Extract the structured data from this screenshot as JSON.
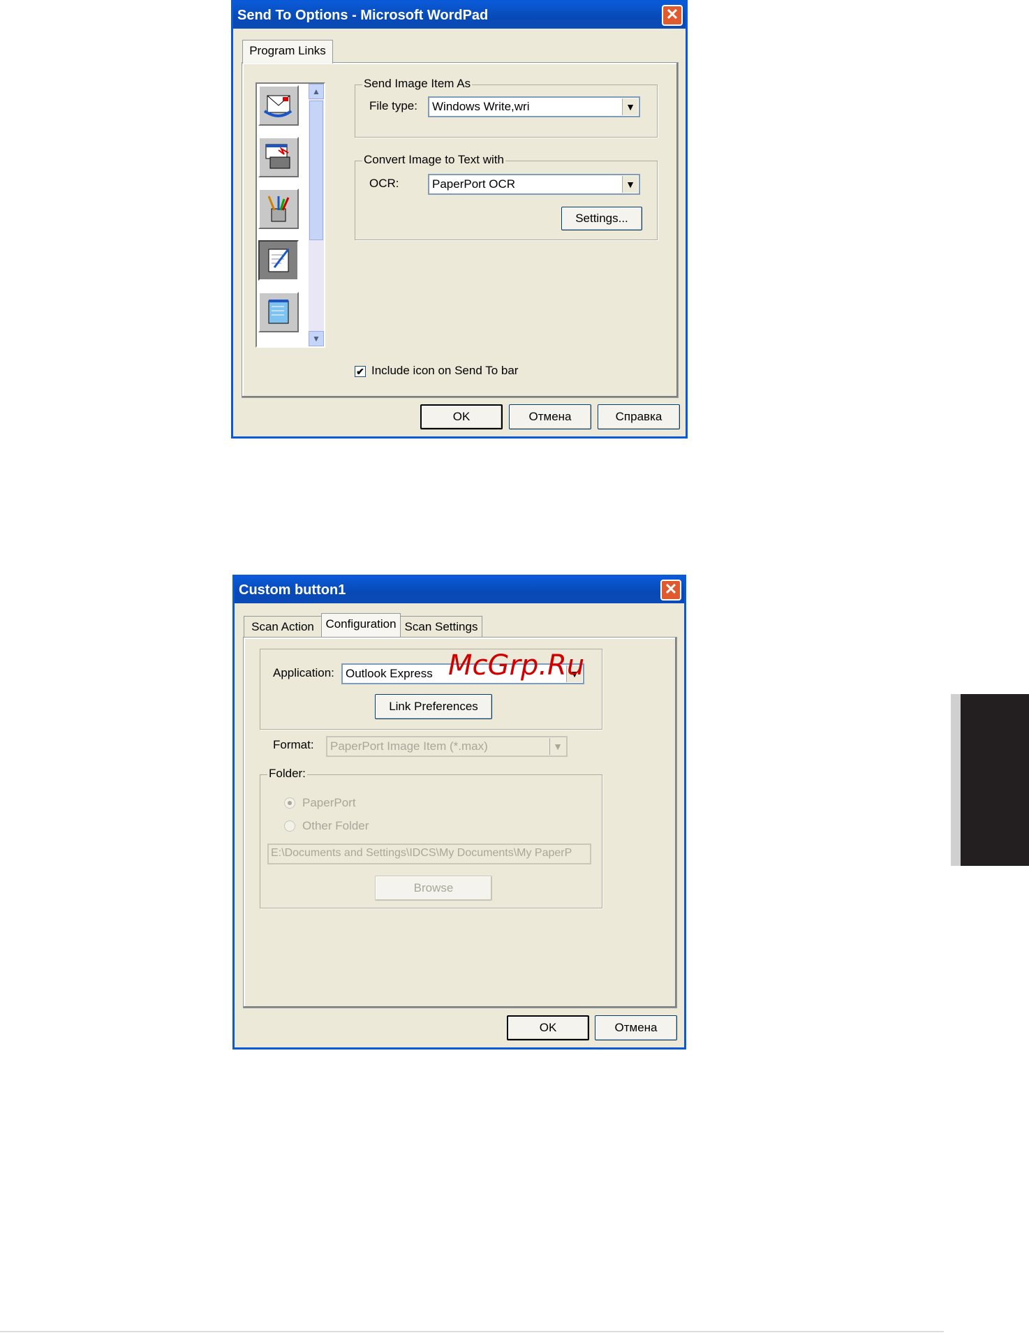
{
  "dialog1": {
    "title": "Send To Options - Microsoft WordPad",
    "tab": "Program Links",
    "group_send": {
      "legend": "Send Image Item As",
      "file_type_label": "File type:",
      "file_type_value": "Windows Write,wri"
    },
    "group_ocr": {
      "legend": "Convert Image to Text with",
      "ocr_label": "OCR:",
      "ocr_value": "PaperPort OCR",
      "settings_button": "Settings..."
    },
    "icons": [
      "mail-send-icon",
      "fax-icon",
      "paint-icon",
      "wordpad-icon",
      "notepad-icon"
    ],
    "include_icon_checkbox": {
      "label": "Include icon on Send To bar",
      "checked": true
    },
    "buttons": {
      "ok": "OK",
      "cancel": "Отмена",
      "help": "Справка"
    }
  },
  "dialog2": {
    "title": "Custom button1",
    "tabs": [
      "Scan Action",
      "Configuration",
      "Scan Settings"
    ],
    "active_tab": "Configuration",
    "application_label": "Application:",
    "application_value": "Outlook Express",
    "link_preferences_button": "Link Preferences",
    "format_label": "Format:",
    "format_value": "PaperPort Image Item (*.max)",
    "folder": {
      "legend": "Folder:",
      "option_paperport": "PaperPort",
      "option_other": "Other Folder",
      "selected": "PaperPort",
      "path": "E:\\Documents and Settings\\IDCS\\My Documents\\My PaperP",
      "browse_button": "Browse"
    },
    "buttons": {
      "ok": "OK",
      "cancel": "Отмена"
    }
  },
  "watermark": "McGrp.Ru",
  "colors": {
    "titlebar": "#0a5ad8",
    "dialog_bg": "#ece9d8",
    "close_button": "#e05a30",
    "disabled_text": "#a9a79a",
    "side_tab": "#231f20"
  }
}
